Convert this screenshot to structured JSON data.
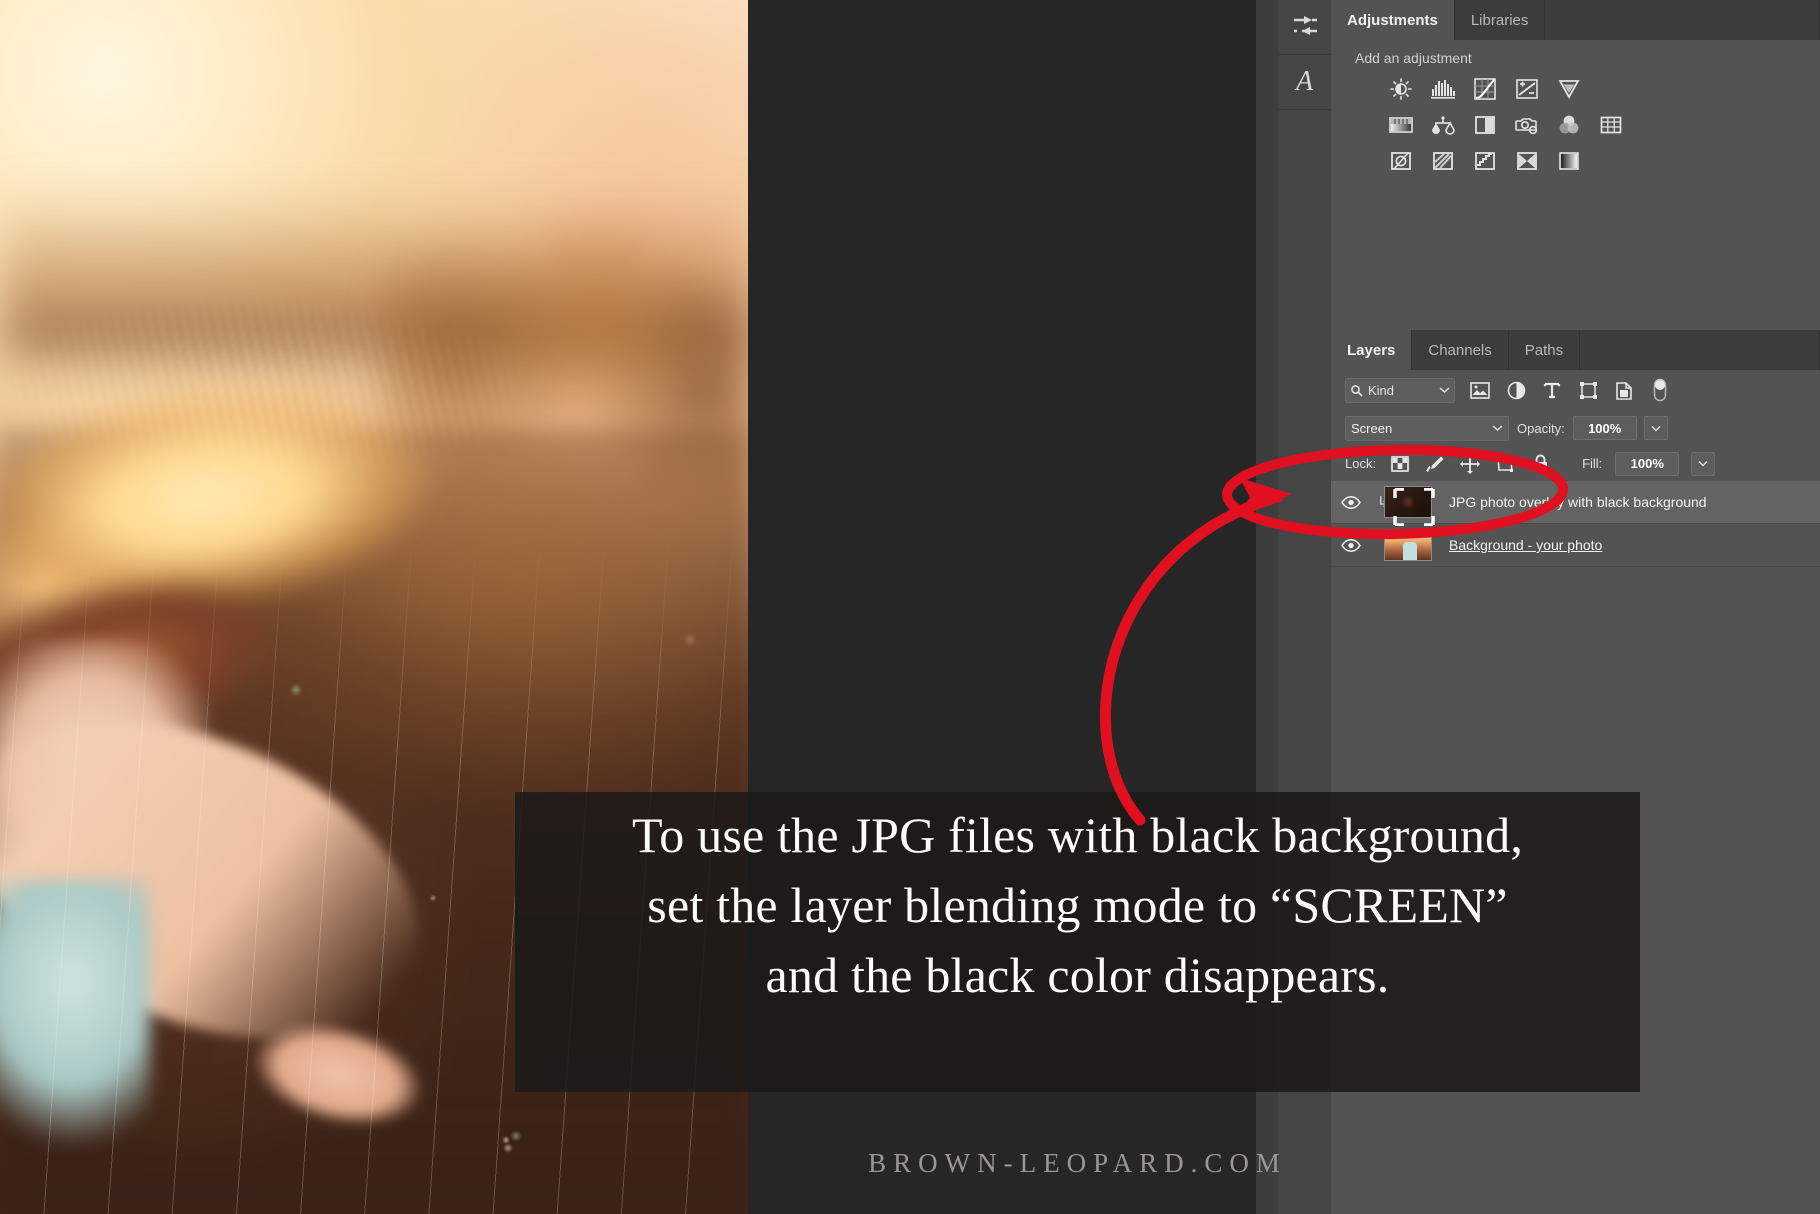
{
  "app": "Adobe Photoshop",
  "toolbar": {
    "buttons": [
      {
        "name": "properties-icon",
        "label": "Properties"
      },
      {
        "name": "character-icon",
        "label": "A"
      }
    ]
  },
  "adjustments_panel": {
    "tabs": [
      {
        "label": "Adjustments",
        "active": true
      },
      {
        "label": "Libraries",
        "active": false
      }
    ],
    "heading": "Add an adjustment",
    "icons": [
      [
        "brightness-contrast-icon",
        "levels-icon",
        "curves-icon",
        "exposure-icon",
        "vibrance-icon"
      ],
      [
        "hue-saturation-icon",
        "color-balance-icon",
        "black-white-icon",
        "photo-filter-icon",
        "channel-mixer-icon",
        "color-lookup-icon"
      ],
      [
        "invert-icon",
        "posterize-icon",
        "threshold-icon",
        "selective-color-icon",
        "gradient-map-icon"
      ]
    ]
  },
  "layers_panel": {
    "tabs": [
      {
        "label": "Layers",
        "active": true
      },
      {
        "label": "Channels",
        "active": false
      },
      {
        "label": "Paths",
        "active": false
      }
    ],
    "filter": {
      "kind_label": "Kind",
      "search_icon": "search-icon",
      "type_filters": [
        "pixel-layer-icon",
        "adjustment-layer-icon",
        "type-layer-icon",
        "shape-layer-icon",
        "smart-object-icon"
      ],
      "toggle": "filter-toggle"
    },
    "blend_mode": "Screen",
    "opacity_label": "Opacity:",
    "opacity_value": "100%",
    "lock_label": "Lock:",
    "lock_icons": [
      "lock-transparency-icon",
      "lock-image-icon",
      "lock-position-icon",
      "lock-artboard-icon",
      "lock-all-icon"
    ],
    "fill_label": "Fill:",
    "fill_value": "100%",
    "layers": [
      {
        "name": "JPG photo overlay with black background",
        "visible": true,
        "selected": true,
        "clipped": true,
        "underline": false,
        "thumb": "dark"
      },
      {
        "name": "Background - your photo",
        "visible": true,
        "selected": false,
        "clipped": false,
        "underline": true,
        "thumb": "photo"
      }
    ]
  },
  "caption": {
    "lines": [
      "To use the JPG files with black background,",
      "set the layer blending mode to “SCREEN”",
      "and the black color disappears."
    ]
  },
  "watermark": "BROWN-LEOPARD.COM",
  "colors": {
    "annotation_red": "#e01020",
    "panel_bg": "#535353",
    "tab_bg": "#3c3c3c",
    "canvas_bg": "#262626",
    "toolcol_bg": "#454545"
  }
}
